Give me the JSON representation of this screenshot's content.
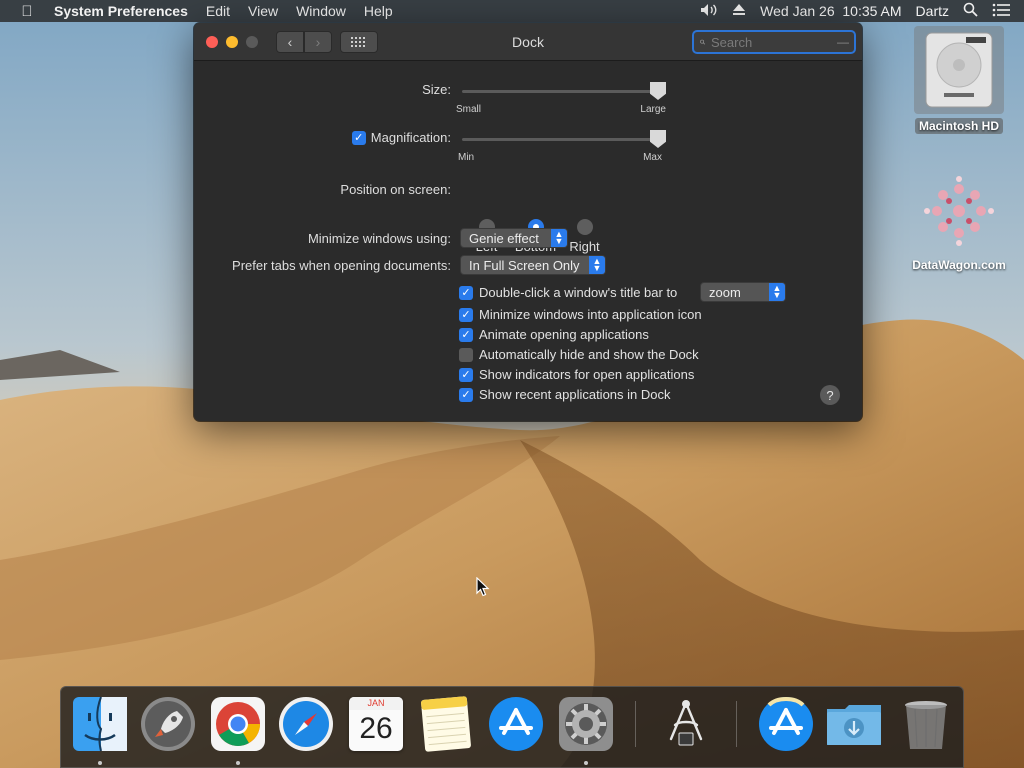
{
  "menubar": {
    "app_name": "System Preferences",
    "menus": [
      "Edit",
      "View",
      "Window",
      "Help"
    ],
    "clock": "Wed Jan 26  10:35 AM",
    "user": "Dartz"
  },
  "window": {
    "title": "Dock",
    "search_placeholder": "Search"
  },
  "settings": {
    "size_label": "Size:",
    "size_min_label": "Small",
    "size_max_label": "Large",
    "size_value": 1.0,
    "magnification_label": "Magnification:",
    "magnification_checked": true,
    "mag_min_label": "Min",
    "mag_max_label": "Max",
    "magnification_value": 1.0,
    "position_label": "Position on screen:",
    "position_options": [
      "Left",
      "Bottom",
      "Right"
    ],
    "position_selected": "Bottom",
    "minimize_label": "Minimize windows using:",
    "minimize_value": "Genie effect",
    "prefer_tabs_label": "Prefer tabs when opening documents:",
    "prefer_tabs_value": "In Full Screen Only",
    "double_click_label": "Double-click a window's title bar to",
    "double_click_value": "zoom",
    "checkboxes": [
      {
        "label": "Double-click a window's title bar to",
        "checked": true
      },
      {
        "label": "Minimize windows into application icon",
        "checked": true
      },
      {
        "label": "Animate opening applications",
        "checked": true
      },
      {
        "label": "Automatically hide and show the Dock",
        "checked": false
      },
      {
        "label": "Show indicators for open applications",
        "checked": true
      },
      {
        "label": "Show recent applications in Dock",
        "checked": true
      }
    ],
    "help": "?"
  },
  "desktop": {
    "icons": [
      {
        "label": "Macintosh HD",
        "icon": "hard-drive-icon"
      },
      {
        "label": "DataWagon.com",
        "icon": "flower-logo-icon"
      }
    ]
  },
  "dock": {
    "calendar_month": "JAN",
    "calendar_day": "26",
    "apps": [
      {
        "name": "finder-icon",
        "running": true
      },
      {
        "name": "launchpad-icon",
        "running": false
      },
      {
        "name": "chrome-icon",
        "running": true
      },
      {
        "name": "safari-icon",
        "running": false
      },
      {
        "name": "calendar-icon",
        "running": false
      },
      {
        "name": "notes-icon",
        "running": false
      },
      {
        "name": "app-store-icon",
        "running": false
      },
      {
        "name": "system-preferences-icon",
        "running": true
      },
      {
        "name": "system-information-icon",
        "running": false
      },
      {
        "name": "app-store-recent-icon",
        "running": false
      },
      {
        "name": "downloads-folder-icon",
        "running": false
      },
      {
        "name": "trash-icon",
        "running": false
      }
    ]
  },
  "colors": {
    "accent": "#2a7bec",
    "window_bg": "#2b2b2b",
    "close": "#fe5f57",
    "minimize": "#febc2e"
  }
}
